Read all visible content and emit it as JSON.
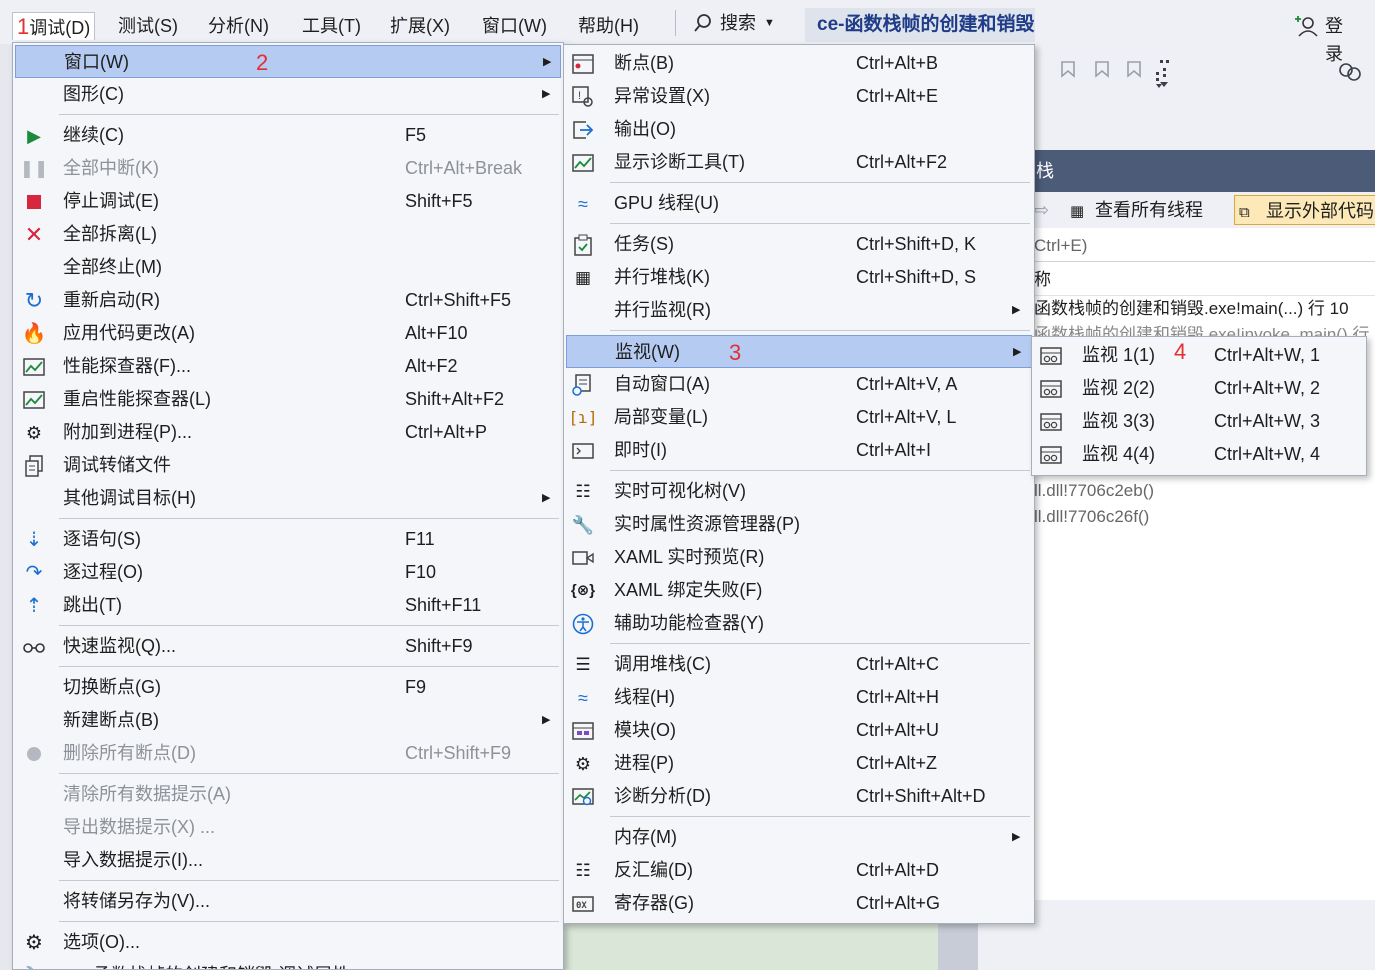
{
  "menubar": {
    "items": [
      {
        "marker": "1",
        "label": "调试(D)"
      },
      {
        "label": "测试(S)"
      },
      {
        "label": "分析(N)"
      },
      {
        "label": "工具(T)"
      },
      {
        "label": "扩展(X)"
      },
      {
        "label": "窗口(W)"
      },
      {
        "label": "帮助(H)"
      }
    ],
    "search_label": "搜索",
    "title": "ce-函数栈帧的创建和销毁",
    "login_label": "登录"
  },
  "debug_menu": {
    "items": [
      {
        "label": "窗口(W)",
        "marker": "2",
        "icon": "none"
      },
      {
        "label": "图形(C)",
        "icon": "none"
      },
      {
        "label": "继续(C)",
        "shortcut": "F5",
        "icon": "play-icon"
      },
      {
        "label": "全部中断(K)",
        "shortcut": "Ctrl+Alt+Break",
        "icon": "pause-icon"
      },
      {
        "label": "停止调试(E)",
        "shortcut": "Shift+F5",
        "icon": "stop-icon"
      },
      {
        "label": "全部拆离(L)",
        "icon": "detach-icon"
      },
      {
        "label": "全部终止(M)",
        "icon": "none"
      },
      {
        "label": "重新启动(R)",
        "shortcut": "Ctrl+Shift+F5",
        "icon": "restart-icon"
      },
      {
        "label": "应用代码更改(A)",
        "shortcut": "Alt+F10",
        "icon": "hot-reload-icon"
      },
      {
        "label": "性能探查器(F)...",
        "shortcut": "Alt+F2",
        "icon": "profiler-icon"
      },
      {
        "label": "重启性能探查器(L)",
        "shortcut": "Shift+Alt+F2",
        "icon": "profiler-restart-icon"
      },
      {
        "label": "附加到进程(P)...",
        "shortcut": "Ctrl+Alt+P",
        "icon": "gears-icon"
      },
      {
        "label": "调试转储文件",
        "icon": "dump-file-icon"
      },
      {
        "label": "其他调试目标(H)",
        "icon": "none"
      },
      {
        "label": "逐语句(S)",
        "shortcut": "F11",
        "icon": "step-into-icon"
      },
      {
        "label": "逐过程(O)",
        "shortcut": "F10",
        "icon": "step-over-icon"
      },
      {
        "label": "跳出(T)",
        "shortcut": "Shift+F11",
        "icon": "step-out-icon"
      },
      {
        "label": "快速监视(Q)...",
        "shortcut": "Shift+F9",
        "icon": "glasses-icon"
      },
      {
        "label": "切换断点(G)",
        "shortcut": "F9",
        "icon": "none"
      },
      {
        "label": "新建断点(B)",
        "icon": "none"
      },
      {
        "label": "删除所有断点(D)",
        "shortcut": "Ctrl+Shift+F9",
        "icon": "delete-breakpoints-icon"
      },
      {
        "label": "清除所有数据提示(A)",
        "icon": "none"
      },
      {
        "label": "导出数据提示(X) ...",
        "icon": "none"
      },
      {
        "label": "导入数据提示(I)...",
        "icon": "none"
      },
      {
        "label": "将转储另存为(V)...",
        "icon": "none"
      },
      {
        "label": "选项(O)...",
        "icon": "gear-icon"
      },
      {
        "label": "函数栈帧的创建和销毁 调试属性",
        "icon": "wrench-icon"
      }
    ]
  },
  "window_menu": {
    "items": [
      {
        "label": "断点(B)",
        "shortcut": "Ctrl+Alt+B",
        "icon": "breakpoints-window-icon"
      },
      {
        "label": "异常设置(X)",
        "shortcut": "Ctrl+Alt+E",
        "icon": "exception-settings-icon"
      },
      {
        "label": "输出(O)",
        "icon": "output-icon"
      },
      {
        "label": "显示诊断工具(T)",
        "shortcut": "Ctrl+Alt+F2",
        "icon": "diagnostics-icon"
      },
      {
        "label": "GPU 线程(U)",
        "icon": "gpu-threads-icon"
      },
      {
        "label": "任务(S)",
        "shortcut": "Ctrl+Shift+D, K",
        "icon": "tasks-icon"
      },
      {
        "label": "并行堆栈(K)",
        "shortcut": "Ctrl+Shift+D, S",
        "icon": "parallel-stacks-icon"
      },
      {
        "label": "并行监视(R)",
        "icon": "none"
      },
      {
        "label": "监视(W)",
        "marker": "3",
        "icon": "none"
      },
      {
        "label": "自动窗口(A)",
        "shortcut": "Ctrl+Alt+V, A",
        "icon": "autos-icon"
      },
      {
        "label": "局部变量(L)",
        "shortcut": "Ctrl+Alt+V, L",
        "icon": "locals-icon"
      },
      {
        "label": "即时(I)",
        "shortcut": "Ctrl+Alt+I",
        "icon": "immediate-icon"
      },
      {
        "label": "实时可视化树(V)",
        "icon": "visual-tree-icon"
      },
      {
        "label": "实时属性资源管理器(P)",
        "icon": "property-explorer-icon"
      },
      {
        "label": "XAML 实时预览(R)",
        "icon": "xaml-preview-icon"
      },
      {
        "label": "XAML 绑定失败(F)",
        "icon": "xaml-binding-icon"
      },
      {
        "label": "辅助功能检查器(Y)",
        "icon": "accessibility-icon"
      },
      {
        "label": "调用堆栈(C)",
        "shortcut": "Ctrl+Alt+C",
        "icon": "call-stack-icon"
      },
      {
        "label": "线程(H)",
        "shortcut": "Ctrl+Alt+H",
        "icon": "threads-icon"
      },
      {
        "label": "模块(O)",
        "shortcut": "Ctrl+Alt+U",
        "icon": "modules-icon"
      },
      {
        "label": "进程(P)",
        "shortcut": "Ctrl+Alt+Z",
        "icon": "processes-icon"
      },
      {
        "label": "诊断分析(D)",
        "shortcut": "Ctrl+Shift+Alt+D",
        "icon": "diagnostic-analysis-icon"
      },
      {
        "label": "内存(M)",
        "icon": "none"
      },
      {
        "label": "反汇编(D)",
        "shortcut": "Ctrl+Alt+D",
        "icon": "disassembly-icon"
      },
      {
        "label": "寄存器(G)",
        "shortcut": "Ctrl+Alt+G",
        "icon": "registers-icon"
      }
    ]
  },
  "watch_menu": {
    "marker": "4",
    "items": [
      {
        "label": "监视 1(1)",
        "shortcut": "Ctrl+Alt+W, 1",
        "icon": "watch-icon"
      },
      {
        "label": "监视 2(2)",
        "shortcut": "Ctrl+Alt+W, 2",
        "icon": "watch-icon"
      },
      {
        "label": "监视 3(3)",
        "shortcut": "Ctrl+Alt+W, 3",
        "icon": "watch-icon"
      },
      {
        "label": "监视 4(4)",
        "shortcut": "Ctrl+Alt+W, 4",
        "icon": "watch-icon"
      }
    ]
  },
  "call_stack_panel": {
    "title": "栈",
    "view_all_threads": "查看所有线程",
    "show_external_code": "显示外部代码",
    "search_hint": "Ctrl+E)",
    "column": "称",
    "rows": [
      "函数栈帧的创建和销毁.exe!main(...) 行 10",
      "函数栈帧的创建和销毁.exe!invoke_main() 行",
      "ll.dll!7706c2eb()",
      "ll.dll!7706c26f()"
    ]
  },
  "colors": {
    "highlight": "#b6cbf2",
    "menu_bg": "#f5f6f9",
    "title_text": "#1f3c88",
    "marker_red": "#e03030"
  }
}
